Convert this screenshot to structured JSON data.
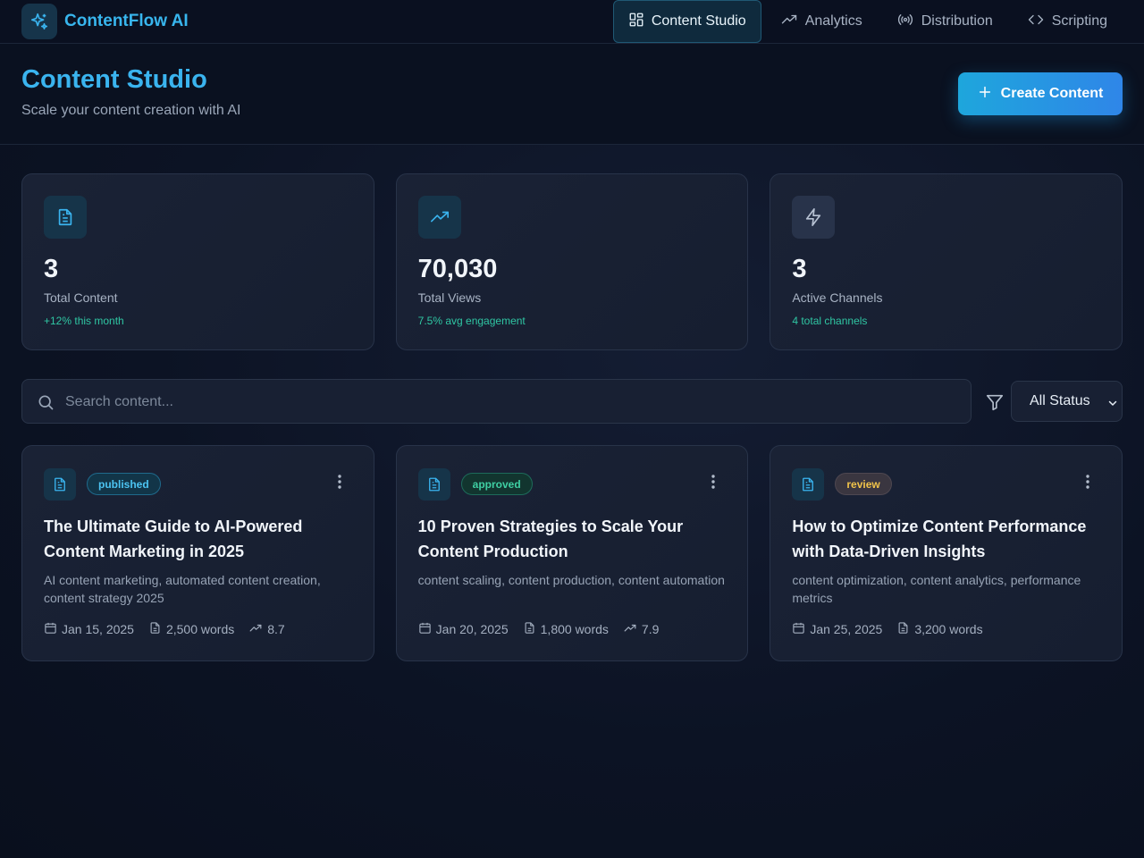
{
  "brand": {
    "name": "ContentFlow AI",
    "icon": "sparkles-icon",
    "accent": "#38b6ee"
  },
  "nav": {
    "items": [
      {
        "label": "Content Studio",
        "icon": "grid-icon",
        "active": true
      },
      {
        "label": "Analytics",
        "icon": "trending-up-icon",
        "active": false
      },
      {
        "label": "Distribution",
        "icon": "broadcast-icon",
        "active": false
      },
      {
        "label": "Scripting",
        "icon": "code-icon",
        "active": false
      }
    ]
  },
  "header": {
    "title": "Content Studio",
    "subtitle": "Scale your content creation with AI",
    "create_label": "Create Content"
  },
  "stats": [
    {
      "value": "3",
      "label": "Total Content",
      "sub": "+12% this month",
      "icon": "document-icon"
    },
    {
      "value": "70,030",
      "label": "Total Views",
      "sub": "7.5% avg engagement",
      "icon": "trending-up-icon"
    },
    {
      "value": "3",
      "label": "Active Channels",
      "sub": "4 total channels",
      "icon": "lightning-icon"
    }
  ],
  "search": {
    "placeholder": "Search content...",
    "value": ""
  },
  "filter": {
    "selected": "All Status"
  },
  "content_cards": [
    {
      "status": "published",
      "title": "The Ultimate Guide to AI-Powered Content Marketing in 2025",
      "keywords": "AI content marketing, automated content creation, content strategy 2025",
      "date": "Jan 15, 2025",
      "words": "2,500 words",
      "score": "8.7"
    },
    {
      "status": "approved",
      "title": "10 Proven Strategies to Scale Your Content Production",
      "keywords": "content scaling, content production, content automation",
      "date": "Jan 20, 2025",
      "words": "1,800 words",
      "score": "7.9"
    },
    {
      "status": "review",
      "title": "How to Optimize Content Performance with Data-Driven Insights",
      "keywords": "content optimization, content analytics, performance metrics",
      "date": "Jan 25, 2025",
      "words": "3,200 words",
      "score": null
    }
  ],
  "colors": {
    "published": "#4cc4f2",
    "approved": "#3fcfa3",
    "review": "#f0c34a",
    "positive": "#2fc6a3"
  }
}
